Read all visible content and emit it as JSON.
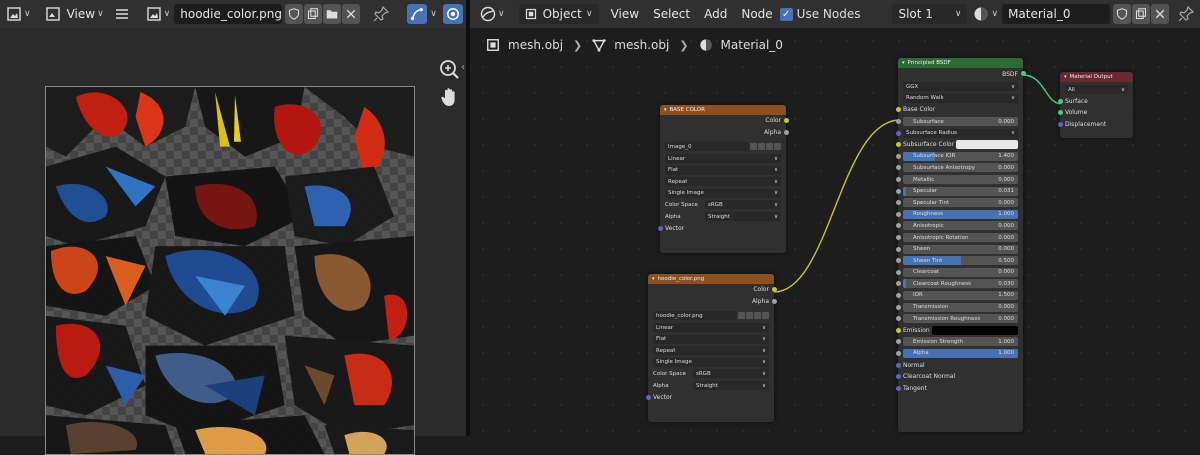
{
  "image_editor": {
    "view_menu": "View",
    "image_name": "hoodie_color.png"
  },
  "node_editor": {
    "mode": "Object",
    "menus": [
      "View",
      "Select",
      "Add",
      "Node"
    ],
    "use_nodes_label": "Use Nodes",
    "slot": "Slot 1",
    "material": "Material_0",
    "breadcrumb": [
      "mesh.obj",
      "mesh.obj",
      "Material_0"
    ]
  },
  "nodes": {
    "base_color": {
      "title": "BASE COLOR",
      "outputs": [
        "Color",
        "Alpha"
      ],
      "image": "Image_0",
      "options": [
        "Linear",
        "Flat",
        "Repeat",
        "Single Image"
      ],
      "color_space_label": "Color Space",
      "color_space": "sRGB",
      "alpha_label": "Alpha",
      "alpha_mode": "Straight",
      "vector": "Vector"
    },
    "hoodie": {
      "title": "hoodie_color.png",
      "outputs": [
        "Color",
        "Alpha"
      ],
      "image": "hoodie_color.png",
      "options": [
        "Linear",
        "Flat",
        "Repeat",
        "Single Image"
      ],
      "color_space_label": "Color Space",
      "color_space": "sRGB",
      "alpha_label": "Alpha",
      "alpha_mode": "Straight",
      "vector": "Vector"
    },
    "bsdf": {
      "title": "Principled BSDF",
      "output": "BSDF",
      "distribution": "GGX",
      "subsurface_method": "Random Walk",
      "base_color": "Base Color",
      "subsurface": {
        "label": "Subsurface",
        "value": "0.000",
        "fill": 0
      },
      "subsurface_radius": "Subsurface Radius",
      "subsurface_color": "Subsurface Color",
      "sliders": [
        {
          "label": "Subsurface IOR",
          "value": "1.400",
          "fill": 0.28
        },
        {
          "label": "Subsurface Anisotropy",
          "value": "0.000",
          "fill": 0
        },
        {
          "label": "Metallic",
          "value": "0.000",
          "fill": 0
        },
        {
          "label": "Specular",
          "value": "0.031",
          "fill": 0.03
        },
        {
          "label": "Specular Tint",
          "value": "0.000",
          "fill": 0
        },
        {
          "label": "Roughness",
          "value": "1.000",
          "fill": 1
        },
        {
          "label": "Anisotropic",
          "value": "0.000",
          "fill": 0
        },
        {
          "label": "Anisotropic Rotation",
          "value": "0.000",
          "fill": 0
        },
        {
          "label": "Sheen",
          "value": "0.000",
          "fill": 0
        },
        {
          "label": "Sheen Tint",
          "value": "0.500",
          "fill": 0.5
        },
        {
          "label": "Clearcoat",
          "value": "0.000",
          "fill": 0
        },
        {
          "label": "Clearcoat Roughness",
          "value": "0.030",
          "fill": 0.03
        },
        {
          "label": "IOR",
          "value": "1.500",
          "fill": 0
        },
        {
          "label": "Transmission",
          "value": "0.000",
          "fill": 0
        },
        {
          "label": "Transmission Roughness",
          "value": "0.000",
          "fill": 0
        }
      ],
      "emission": "Emission",
      "emission_strength": {
        "label": "Emission Strength",
        "value": "1.000",
        "fill": 0
      },
      "alpha": {
        "label": "Alpha",
        "value": "1.000",
        "fill": 1
      },
      "normal": "Normal",
      "clearcoat_normal": "Clearcoat Normal",
      "tangent": "Tangent"
    },
    "output": {
      "title": "Material Output",
      "target": "All",
      "inputs": [
        "Surface",
        "Volume",
        "Displacement"
      ]
    }
  }
}
